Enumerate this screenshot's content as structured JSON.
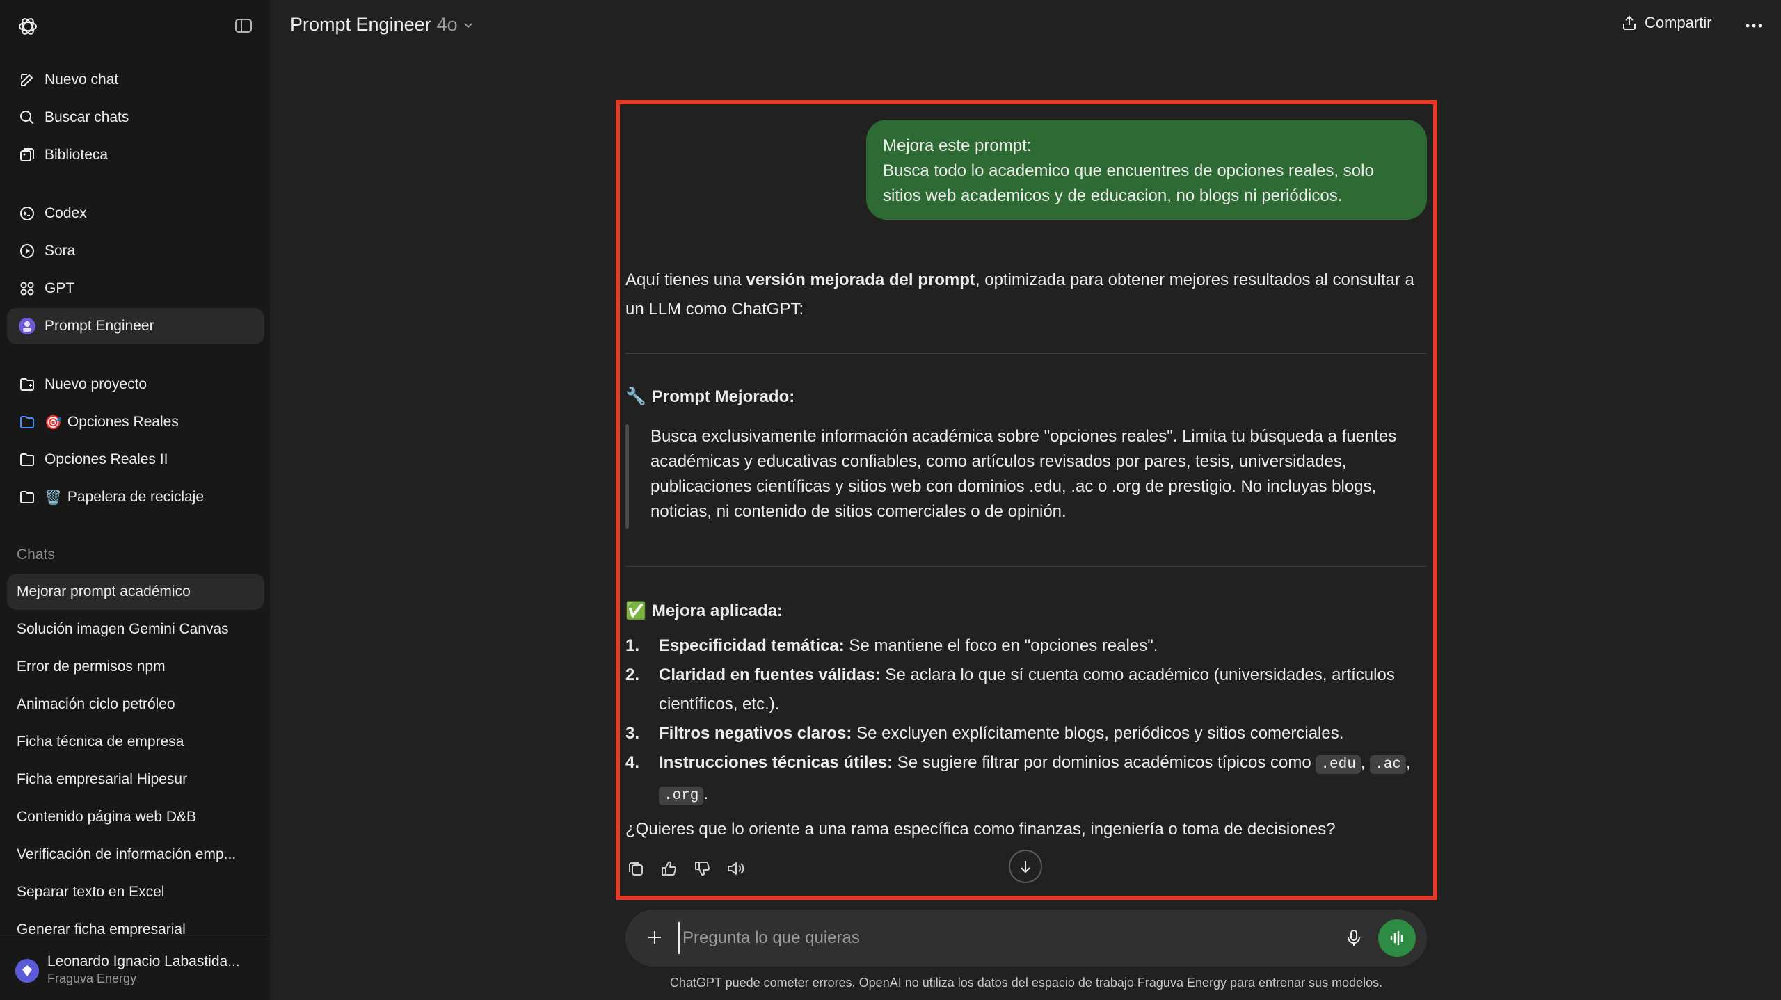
{
  "sidebar": {
    "top": [
      {
        "label": "Nuevo chat",
        "icon": "new-chat-icon"
      },
      {
        "label": "Buscar chats",
        "icon": "search-icon"
      },
      {
        "label": "Biblioteca",
        "icon": "library-icon"
      }
    ],
    "tools": [
      {
        "label": "Codex",
        "icon": "codex-icon"
      },
      {
        "label": "Sora",
        "icon": "sora-icon"
      },
      {
        "label": "GPT",
        "icon": "gpt-grid-icon"
      },
      {
        "label": "Prompt Engineer",
        "icon": "prompt-engineer-avatar-icon"
      }
    ],
    "projects": [
      {
        "label": "Nuevo proyecto",
        "icon": "new-folder-icon",
        "emoji": ""
      },
      {
        "label": "Opciones Reales",
        "icon": "folder-icon",
        "emoji": "🎯"
      },
      {
        "label": "Opciones Reales II",
        "icon": "folder-icon",
        "emoji": ""
      },
      {
        "label": "Papelera de reciclaje",
        "icon": "folder-icon",
        "emoji": "🗑️"
      }
    ],
    "chats_heading": "Chats",
    "chats": [
      "Mejorar prompt académico",
      "Solución imagen Gemini Canvas",
      "Error de permisos npm",
      "Animación ciclo petróleo",
      "Ficha técnica de empresa",
      "Ficha empresarial Hipesur",
      "Contenido página web D&B",
      "Verificación de información emp...",
      "Separar texto en Excel",
      "Generar ficha empresarial"
    ],
    "user": {
      "name": "Leonardo Ignacio Labastida...",
      "org": "Fraguva Energy"
    }
  },
  "header": {
    "title": "Prompt Engineer",
    "version": "4o",
    "share": "Compartir"
  },
  "conversation": {
    "user_line1": "Mejora este prompt:",
    "user_line2": "Busca todo lo academico que encuentres de opciones reales, solo sitios web academicos y de educacion, no blogs ni periódicos.",
    "intro_a": "Aquí tienes una ",
    "intro_b": "versión mejorada del prompt",
    "intro_c": ", optimizada para obtener mejores resultados al consultar a un LLM como ChatGPT:",
    "section1_emoji": "🔧",
    "section1_title": "Prompt Mejorado:",
    "improved_prompt": "Busca exclusivamente información académica sobre \"opciones reales\". Limita tu búsqueda a fuentes académicas y educativas confiables, como artículos revisados por pares, tesis, universidades, publicaciones científicas y sitios web con dominios .edu, .ac o .org de prestigio. No incluyas blogs, noticias, ni contenido de sitios comerciales o de opinión.",
    "section2_emoji": "✅",
    "section2_title": "Mejora aplicada:",
    "list": [
      {
        "num": "1.",
        "bold": "Especificidad temática:",
        "text": " Se mantiene el foco en \"opciones reales\"."
      },
      {
        "num": "2.",
        "bold": "Claridad en fuentes válidas:",
        "text": " Se aclara lo que sí cuenta como académico (universidades, artículos científicos, etc.)."
      },
      {
        "num": "3.",
        "bold": "Filtros negativos claros:",
        "text": " Se excluyen explícitamente blogs, periódicos y sitios comerciales."
      },
      {
        "num": "4.",
        "bold": "Instrucciones técnicas útiles:",
        "text": " Se sugiere filtrar por dominios académicos típicos como "
      }
    ],
    "codes": [
      ".edu",
      ".ac",
      ".org"
    ],
    "comma": ",",
    "period": ".",
    "question": "¿Quieres que lo oriente a una rama específica como finanzas, ingeniería o toma de decisiones?"
  },
  "composer": {
    "placeholder": "Pregunta lo que quieras"
  },
  "disclaimer": "ChatGPT puede cometer errores. OpenAI no utiliza los datos del espacio de trabajo Fraguva Energy para entrenar sus modelos.",
  "colors": {
    "user_bubble": "#2e6b34",
    "highlight_border": "#e53a25",
    "voice_button": "#2e8b43"
  }
}
